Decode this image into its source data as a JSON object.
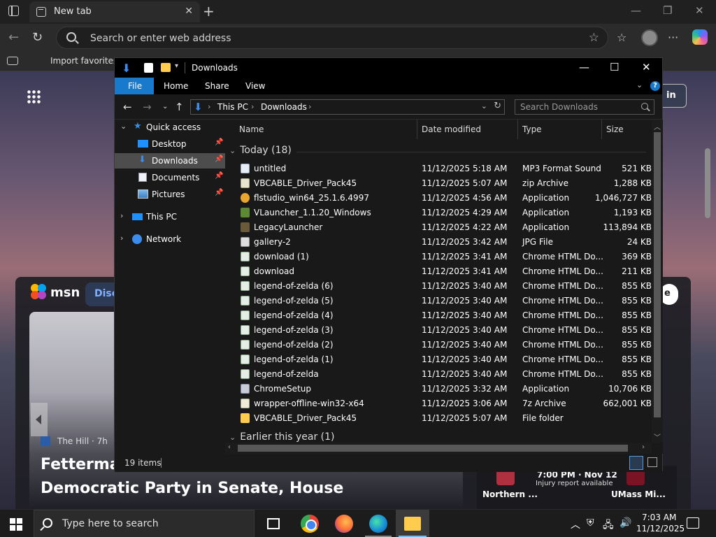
{
  "browser": {
    "tab_title": "New tab",
    "address_placeholder": "Search or enter web address",
    "favorites_item": "Import favorites"
  },
  "newtab": {
    "signin_label": "in",
    "msn_label": "msn",
    "discover_label": "Disco",
    "feed_button_label": "e",
    "hero_source": "The Hill · 7h",
    "hero_headline_line1": "Fetterman",
    "hero_headline_line2": "Democratic Party in Senate, House",
    "sports_time": "7:00 PM · Nov 12",
    "sports_sub": "Injury report available",
    "sports_team1": "Northern ...",
    "sports_team2": "UMass Mi..."
  },
  "explorer": {
    "title": "Downloads",
    "ribbon_tabs": [
      "File",
      "Home",
      "Share",
      "View"
    ],
    "breadcrumb": [
      "This PC",
      "Downloads"
    ],
    "search_placeholder": "Search Downloads",
    "sidebar": {
      "quick_access": "Quick access",
      "items": [
        "Desktop",
        "Downloads",
        "Documents",
        "Pictures"
      ],
      "this_pc": "This PC",
      "network": "Network"
    },
    "columns": [
      "Name",
      "Date modified",
      "Type",
      "Size"
    ],
    "group_today": "Today (18)",
    "group_earlier": "Earlier this year (1)",
    "files": [
      {
        "name": "untitled",
        "date": "11/12/2025 5:18 AM",
        "type": "MP3 Format Sound",
        "size": "521 KB",
        "icon": "audio-file-icon"
      },
      {
        "name": "VBCABLE_Driver_Pack45",
        "date": "11/12/2025 5:07 AM",
        "type": "zip Archive",
        "size": "1,288 KB",
        "icon": "zip-file-icon"
      },
      {
        "name": "flstudio_win64_25.1.6.4997",
        "date": "11/12/2025 4:56 AM",
        "type": "Application",
        "size": "1,046,727 KB",
        "icon": "flstudio-app-icon"
      },
      {
        "name": "VLauncher_1.1.20_Windows",
        "date": "11/12/2025 4:29 AM",
        "type": "Application",
        "size": "1,193 KB",
        "icon": "minecraft-grass-icon"
      },
      {
        "name": "LegacyLauncher",
        "date": "11/12/2025 4:22 AM",
        "type": "Application",
        "size": "113,894 KB",
        "icon": "minecraft-dirt-icon"
      },
      {
        "name": "gallery-2",
        "date": "11/12/2025 3:42 AM",
        "type": "JPG File",
        "size": "24 KB",
        "icon": "jpg-file-icon"
      },
      {
        "name": "download (1)",
        "date": "11/12/2025 3:41 AM",
        "type": "Chrome HTML Do...",
        "size": "369 KB",
        "icon": "chrome-html-icon"
      },
      {
        "name": "download",
        "date": "11/12/2025 3:41 AM",
        "type": "Chrome HTML Do...",
        "size": "211 KB",
        "icon": "chrome-html-icon"
      },
      {
        "name": "legend-of-zelda (6)",
        "date": "11/12/2025 3:40 AM",
        "type": "Chrome HTML Do...",
        "size": "855 KB",
        "icon": "chrome-html-icon"
      },
      {
        "name": "legend-of-zelda (5)",
        "date": "11/12/2025 3:40 AM",
        "type": "Chrome HTML Do...",
        "size": "855 KB",
        "icon": "chrome-html-icon"
      },
      {
        "name": "legend-of-zelda (4)",
        "date": "11/12/2025 3:40 AM",
        "type": "Chrome HTML Do...",
        "size": "855 KB",
        "icon": "chrome-html-icon"
      },
      {
        "name": "legend-of-zelda (3)",
        "date": "11/12/2025 3:40 AM",
        "type": "Chrome HTML Do...",
        "size": "855 KB",
        "icon": "chrome-html-icon"
      },
      {
        "name": "legend-of-zelda (2)",
        "date": "11/12/2025 3:40 AM",
        "type": "Chrome HTML Do...",
        "size": "855 KB",
        "icon": "chrome-html-icon"
      },
      {
        "name": "legend-of-zelda (1)",
        "date": "11/12/2025 3:40 AM",
        "type": "Chrome HTML Do...",
        "size": "855 KB",
        "icon": "chrome-html-icon"
      },
      {
        "name": "legend-of-zelda",
        "date": "11/12/2025 3:40 AM",
        "type": "Chrome HTML Do...",
        "size": "855 KB",
        "icon": "chrome-html-icon"
      },
      {
        "name": "ChromeSetup",
        "date": "11/12/2025 3:32 AM",
        "type": "Application",
        "size": "10,706 KB",
        "icon": "setup-app-icon"
      },
      {
        "name": "wrapper-offline-win32-x64",
        "date": "11/12/2025 3:06 AM",
        "type": "7z Archive",
        "size": "662,001 KB",
        "icon": "7z-file-icon"
      },
      {
        "name": "VBCABLE_Driver_Pack45",
        "date": "11/12/2025 5:07 AM",
        "type": "File folder",
        "size": "",
        "icon": "folder-icon"
      }
    ],
    "status_items": "19 items"
  },
  "taskbar": {
    "search_placeholder": "Type here to search",
    "time": "7:03 AM",
    "date": "11/12/2025"
  }
}
